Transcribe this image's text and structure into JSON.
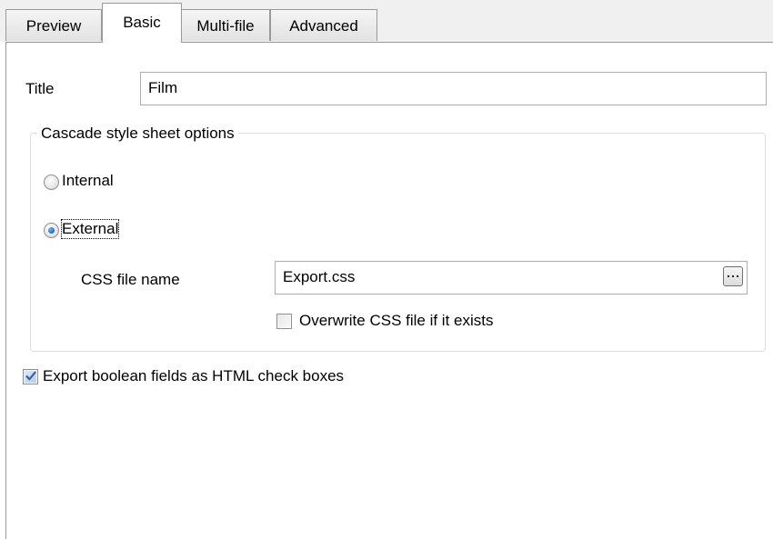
{
  "tabs": [
    {
      "label": "Preview",
      "active": false
    },
    {
      "label": "Basic",
      "active": true
    },
    {
      "label": "Multi-file",
      "active": false
    },
    {
      "label": "Advanced",
      "active": false
    }
  ],
  "form": {
    "title_label": "Title",
    "title_value": "Film",
    "css_group": {
      "legend": "Cascade style sheet options",
      "internal_label": "Internal",
      "internal_selected": false,
      "external_label": "External",
      "external_selected": true,
      "css_file_label": "CSS file name",
      "css_file_value": "Export.css",
      "overwrite_label": "Overwrite CSS file if it exists",
      "overwrite_checked": false
    },
    "export_boolean_label": "Export boolean fields as HTML check boxes",
    "export_boolean_checked": true
  },
  "icons": {
    "browse": "ellipsis-icon",
    "check": "checkmark-icon"
  },
  "colors": {
    "radio_selected": "#1f66c4",
    "checkmark": "#3a5fa8",
    "group_border": "#d5dfe5"
  }
}
